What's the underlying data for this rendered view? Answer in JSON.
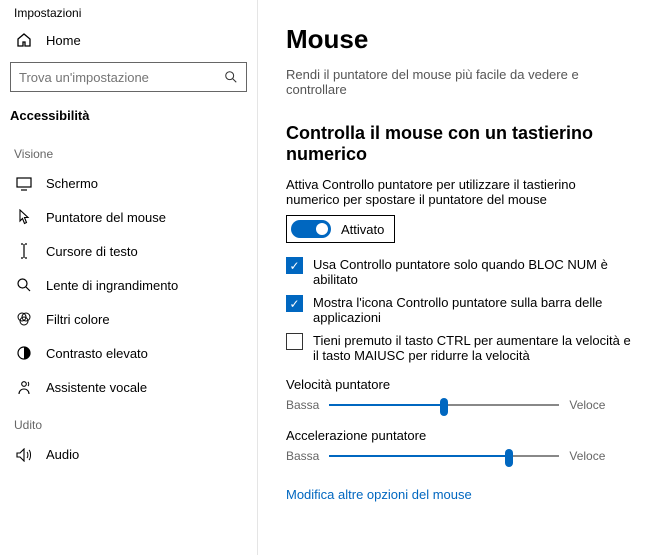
{
  "window_title": "Impostazioni",
  "home_label": "Home",
  "search": {
    "placeholder": "Trova un'impostazione"
  },
  "current_section": "Accessibilità",
  "groups": [
    {
      "label": "Visione",
      "items": [
        {
          "key": "schermo",
          "label": "Schermo"
        },
        {
          "key": "puntatore",
          "label": "Puntatore del mouse"
        },
        {
          "key": "cursore",
          "label": "Cursore di testo"
        },
        {
          "key": "lente",
          "label": "Lente di ingrandimento"
        },
        {
          "key": "filtri",
          "label": "Filtri colore"
        },
        {
          "key": "contrasto",
          "label": "Contrasto elevato"
        },
        {
          "key": "assistente",
          "label": "Assistente vocale"
        }
      ]
    },
    {
      "label": "Udito",
      "items": [
        {
          "key": "audio",
          "label": "Audio"
        }
      ]
    }
  ],
  "page": {
    "title": "Mouse",
    "subtitle": "Rendi il puntatore del mouse più facile da vedere e controllare",
    "section_heading": "Controlla il mouse con un tastierino numerico",
    "toggle_desc": "Attiva Controllo puntatore per utilizzare il tastierino numerico per spostare il puntatore del mouse",
    "toggle_state_label": "Attivato",
    "checks": [
      {
        "checked": true,
        "label": "Usa Controllo puntatore solo quando BLOC NUM è abilitato"
      },
      {
        "checked": true,
        "label": "Mostra l'icona Controllo puntatore sulla barra delle applicazioni"
      },
      {
        "checked": false,
        "label": "Tieni premuto il tasto CTRL per aumentare la velocità e il tasto MAIUSC per ridurre la velocità"
      }
    ],
    "sliders": [
      {
        "label": "Velocità puntatore",
        "low": "Bassa",
        "high": "Veloce",
        "value": 50
      },
      {
        "label": "Accelerazione puntatore",
        "low": "Bassa",
        "high": "Veloce",
        "value": 78
      }
    ],
    "link": "Modifica altre opzioni del mouse"
  }
}
